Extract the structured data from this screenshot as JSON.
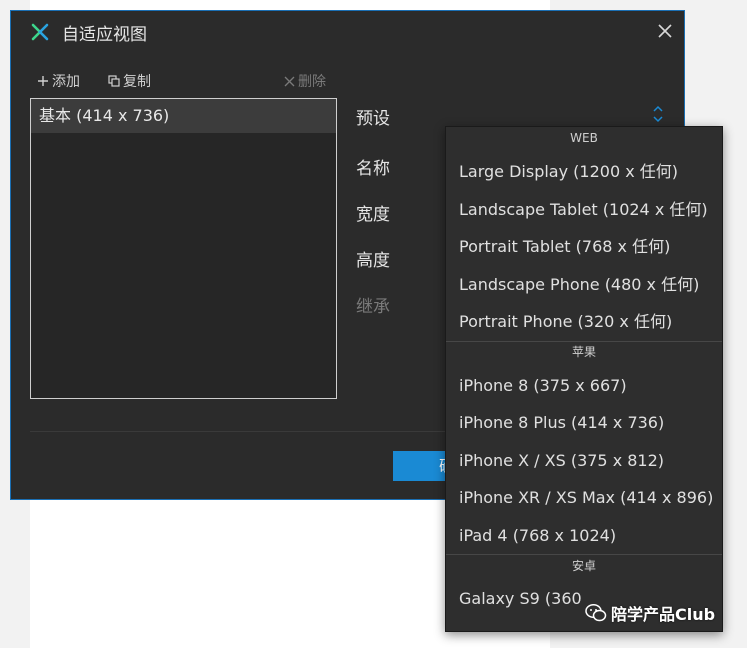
{
  "dialog": {
    "title": "自适应视图",
    "toolbar": {
      "add_label": "添加",
      "copy_label": "复制",
      "delete_label": "删除"
    },
    "views_list": [
      "基本 (414 x 736)"
    ],
    "form": {
      "preset_label": "预设",
      "name_label": "名称",
      "width_label": "宽度",
      "height_label": "高度",
      "inherit_label": "继承"
    },
    "confirm_label": "确"
  },
  "preset_menu": {
    "groups": [
      {
        "header": "WEB",
        "items": [
          "Large Display (1200 x 任何)",
          "Landscape Tablet (1024 x 任何)",
          "Portrait Tablet (768 x 任何)",
          "Landscape Phone (480 x 任何)",
          "Portrait Phone (320 x 任何)"
        ]
      },
      {
        "header": "苹果",
        "items": [
          "iPhone 8 (375 x 667)",
          "iPhone 8 Plus (414 x 736)",
          "iPhone X / XS (375 x 812)",
          "iPhone XR / XS Max (414 x 896)",
          "iPad 4 (768 x 1024)"
        ]
      },
      {
        "header": "安卓",
        "items": [
          "Galaxy S9 (360"
        ]
      }
    ]
  },
  "watermark": {
    "text": "陪学产品Club"
  },
  "colors": {
    "accent": "#1a8ad4",
    "dialog_bg": "#2b2b2b",
    "menu_bg": "#2e2e2e",
    "logo_green": "#3dd68c",
    "logo_blue": "#2aa3e0"
  }
}
